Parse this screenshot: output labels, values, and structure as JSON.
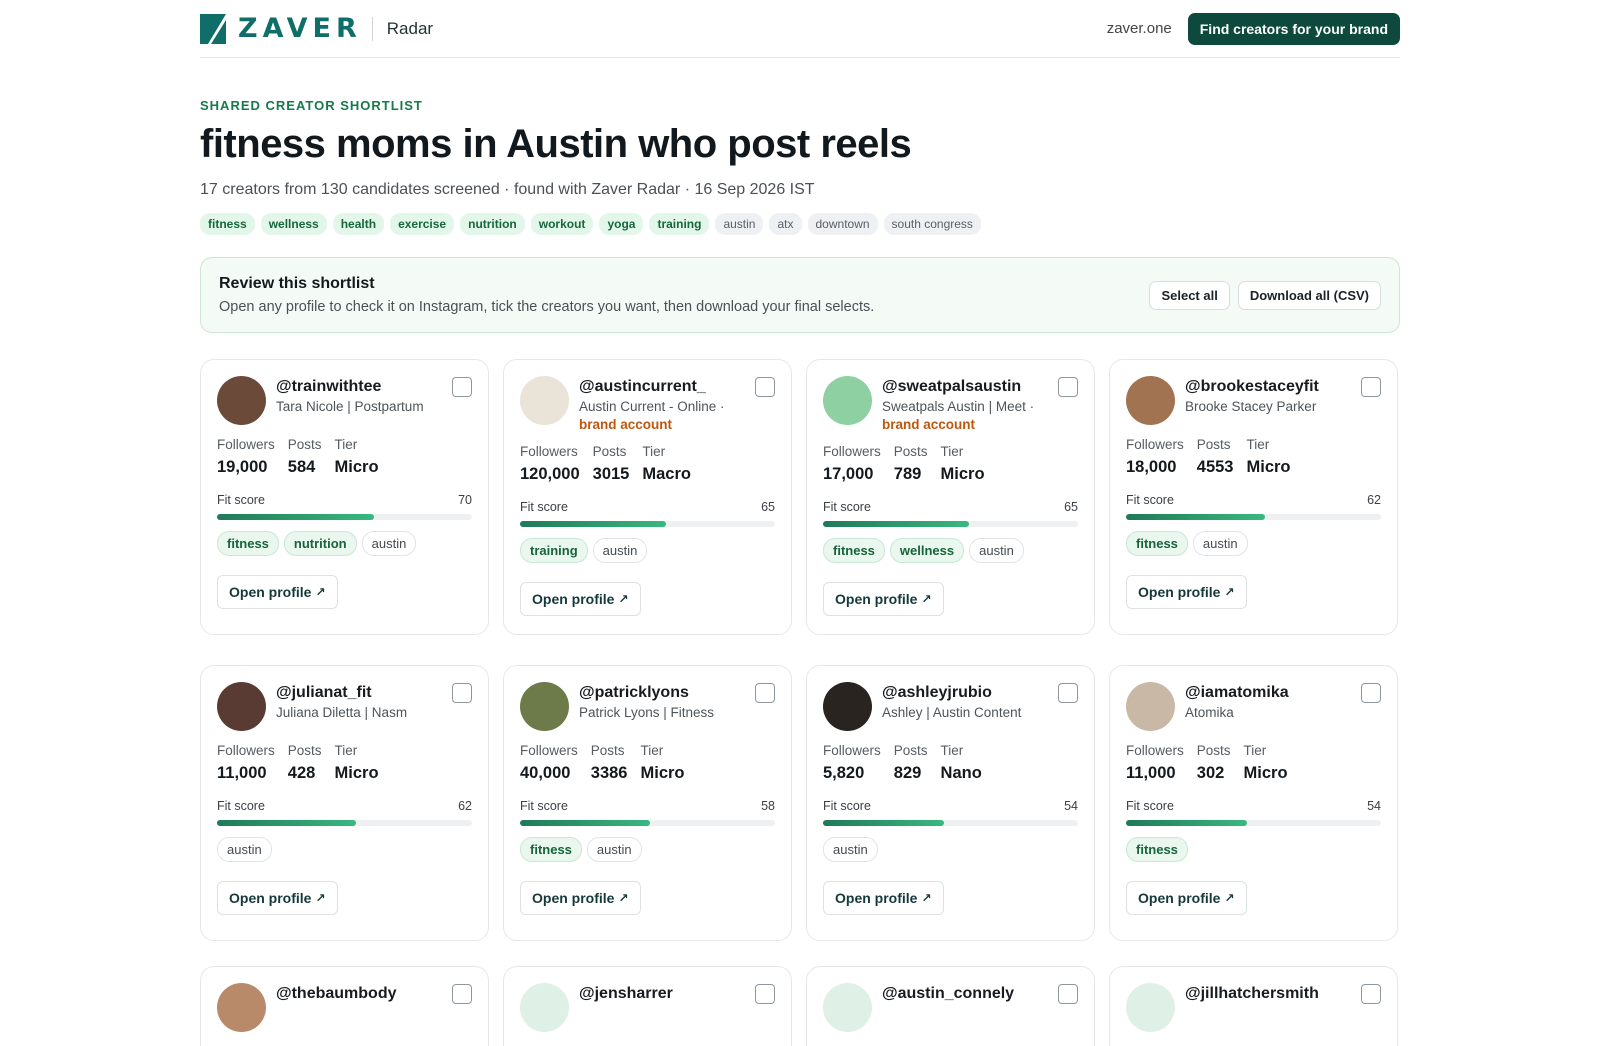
{
  "header": {
    "logo_text": "ZAVER",
    "product": "Radar",
    "site": "zaver.one",
    "cta": "Find creators for your brand"
  },
  "hero": {
    "eyebrow": "SHARED CREATOR SHORTLIST",
    "title": "fitness moms in Austin who post reels",
    "subtitle": "17 creators from 130 candidates screened · found with Zaver Radar · 16 Sep 2026 IST",
    "tags": [
      {
        "label": "fitness",
        "kind": "green"
      },
      {
        "label": "wellness",
        "kind": "green"
      },
      {
        "label": "health",
        "kind": "green"
      },
      {
        "label": "exercise",
        "kind": "green"
      },
      {
        "label": "nutrition",
        "kind": "green"
      },
      {
        "label": "workout",
        "kind": "green"
      },
      {
        "label": "yoga",
        "kind": "green"
      },
      {
        "label": "training",
        "kind": "green"
      },
      {
        "label": "austin",
        "kind": "gray"
      },
      {
        "label": "atx",
        "kind": "gray"
      },
      {
        "label": "downtown",
        "kind": "gray"
      },
      {
        "label": "south congress",
        "kind": "gray"
      }
    ]
  },
  "review": {
    "title": "Review this shortlist",
    "text": "Open any profile to check it on Instagram, tick the creators you want, then download your final selects.",
    "select_all": "Select all",
    "download": "Download all (CSV)"
  },
  "labels": {
    "followers": "Followers",
    "posts": "Posts",
    "tier": "Tier",
    "fit_score": "Fit score",
    "open_profile": "Open profile",
    "brand_account": "brand account"
  },
  "creators": [
    {
      "handle": "@trainwithtee",
      "bio": "Tara Nicole | Postpartum",
      "brand": false,
      "followers": "19,000",
      "posts": "584",
      "tier": "Micro",
      "score": "70",
      "tags": [
        {
          "t": "fitness",
          "g": true
        },
        {
          "t": "nutrition",
          "g": true
        },
        {
          "t": "austin",
          "g": false
        }
      ],
      "avatar_color": "#6b4a3a"
    },
    {
      "handle": "@austincurrent_",
      "bio": "Austin Current - Online ·",
      "brand": true,
      "followers": "120,000",
      "posts": "3015",
      "tier": "Macro",
      "score": "65",
      "tags": [
        {
          "t": "training",
          "g": true
        },
        {
          "t": "austin",
          "g": false
        }
      ],
      "avatar_color": "#e9e3d8"
    },
    {
      "handle": "@sweatpalsaustin",
      "bio": "Sweatpals Austin | Meet ·",
      "brand": true,
      "followers": "17,000",
      "posts": "789",
      "tier": "Micro",
      "score": "65",
      "tags": [
        {
          "t": "fitness",
          "g": true
        },
        {
          "t": "wellness",
          "g": true
        },
        {
          "t": "austin",
          "g": false
        }
      ],
      "avatar_color": "#8fd0a3"
    },
    {
      "handle": "@brookestaceyfit",
      "bio": "Brooke Stacey Parker",
      "brand": false,
      "followers": "18,000",
      "posts": "4553",
      "tier": "Micro",
      "score": "62",
      "tags": [
        {
          "t": "fitness",
          "g": true
        },
        {
          "t": "austin",
          "g": false
        }
      ],
      "avatar_color": "#a27350"
    },
    {
      "handle": "@julianat_fit",
      "bio": "Juliana Diletta | Nasm",
      "brand": false,
      "followers": "11,000",
      "posts": "428",
      "tier": "Micro",
      "score": "62",
      "tags": [
        {
          "t": "austin",
          "g": false
        }
      ],
      "avatar_color": "#5a3b33"
    },
    {
      "handle": "@patricklyons",
      "bio": "Patrick Lyons | Fitness",
      "brand": false,
      "followers": "40,000",
      "posts": "3386",
      "tier": "Micro",
      "score": "58",
      "tags": [
        {
          "t": "fitness",
          "g": true
        },
        {
          "t": "austin",
          "g": false
        }
      ],
      "avatar_color": "#6d7a4a"
    },
    {
      "handle": "@ashleyjrubio",
      "bio": "Ashley | Austin Content",
      "brand": false,
      "followers": "5,820",
      "posts": "829",
      "tier": "Nano",
      "score": "54",
      "tags": [
        {
          "t": "austin",
          "g": false
        }
      ],
      "avatar_color": "#2a2420"
    },
    {
      "handle": "@iamatomika",
      "bio": "Atomika",
      "brand": false,
      "followers": "11,000",
      "posts": "302",
      "tier": "Micro",
      "score": "54",
      "tags": [
        {
          "t": "fitness",
          "g": true
        }
      ],
      "avatar_color": "#c9b8a5"
    }
  ],
  "peek": [
    {
      "handle": "@thebaumbody",
      "avatar_color": "#b98a6a"
    },
    {
      "handle": "@jensharrer",
      "avatar_color": "#dff0e6"
    },
    {
      "handle": "@austin_connely",
      "avatar_color": "#dff0e6"
    },
    {
      "handle": "@jillhatchersmith",
      "avatar_color": "#dff0e6"
    }
  ],
  "colors": {
    "brand": "#0f6e68",
    "cta": "#0d4a3d",
    "accent_green": "#157a4c",
    "brand_account": "#c0570f"
  }
}
